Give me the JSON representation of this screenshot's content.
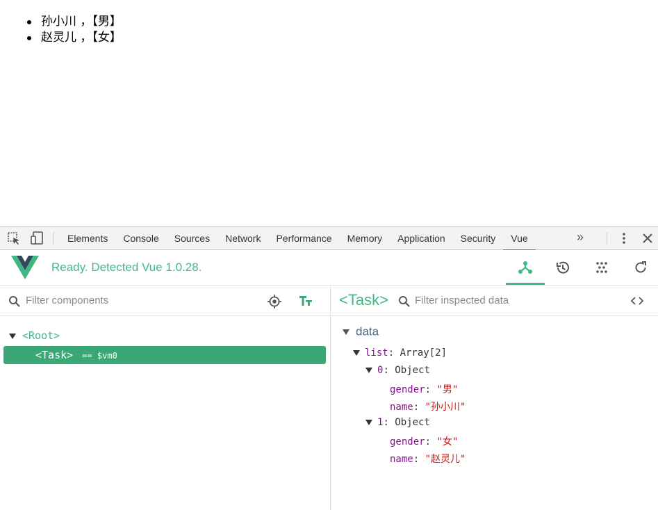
{
  "page": {
    "items": [
      "孙小川 ，【男】",
      "赵灵儿 ，【女】"
    ]
  },
  "devtools": {
    "tabs": [
      "Elements",
      "Console",
      "Sources",
      "Network",
      "Performance",
      "Memory",
      "Application",
      "Security",
      "Vue"
    ],
    "active_tab": "Vue",
    "more_label": "»",
    "inspect_icon": "inspect-element-icon",
    "device_icon": "device-toolbar-icon",
    "menu_icon": "kebab-menu-icon",
    "close_icon": "close-icon",
    "accent": "#1a73e8"
  },
  "vue": {
    "status": "Ready. Detected Vue 1.0.28.",
    "brand_color": "#42b983",
    "header_buttons": [
      "components-icon",
      "history-icon",
      "events-icon",
      "refresh-icon"
    ],
    "left": {
      "filter_placeholder": "Filter components",
      "tree": {
        "root_label": "<Root>",
        "child_label": "<Task>",
        "child_suffix": "== $vm0"
      }
    },
    "right": {
      "component_name": "<Task>",
      "filter_placeholder": "Filter inspected data",
      "section": "data",
      "list_key": "list",
      "list_value": "Array[2]",
      "items": [
        {
          "index": "0",
          "type": "Object",
          "gender_key": "gender",
          "gender": "\"男\"",
          "name_key": "name",
          "name": "\"孙小川\""
        },
        {
          "index": "1",
          "type": "Object",
          "gender_key": "gender",
          "gender": "\"女\"",
          "name_key": "name",
          "name": "\"赵灵儿\""
        }
      ]
    }
  }
}
